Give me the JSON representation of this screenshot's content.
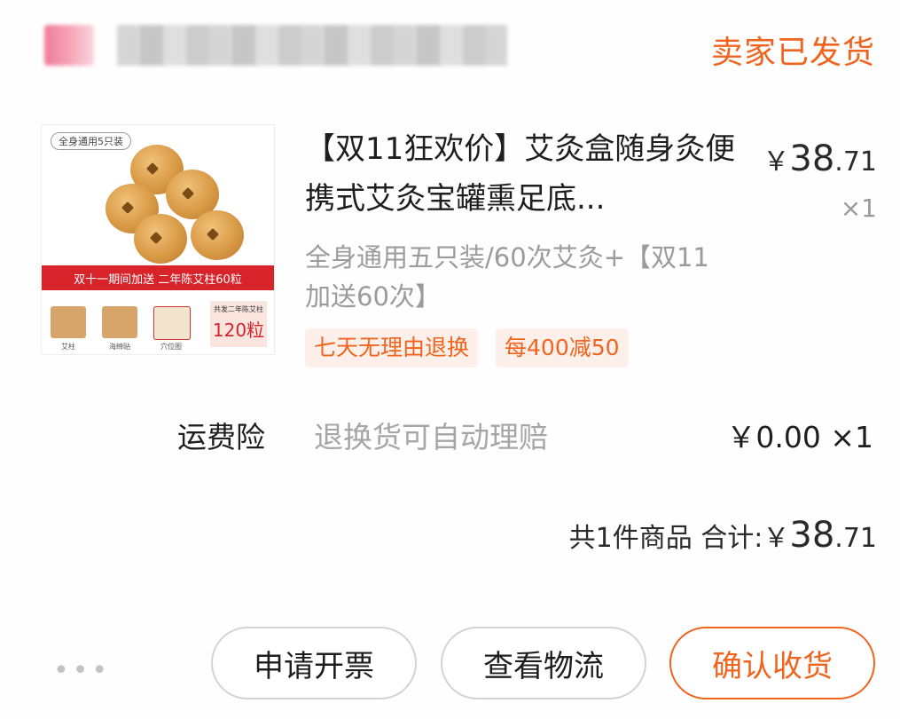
{
  "header": {
    "status": "卖家已发货"
  },
  "product": {
    "image": {
      "tag": "全身通用5只装",
      "band_text": "双十一期间加送 二年陈艾柱60粒",
      "count_small": "共发二年陈艾柱",
      "count_big": "120粒",
      "pack_labels": [
        "艾柱",
        "海绵贴",
        "穴位图"
      ]
    },
    "title": "【双11狂欢价】艾灸盒随身灸便携式艾灸宝罐熏足底...",
    "price": {
      "yen": "￥",
      "integer": "38",
      "decimal": ".71"
    },
    "quantity": "×1",
    "sku": "全身通用五只装/60次艾灸+【双11加送60次】",
    "tags": [
      "七天无理由退换",
      "每400减50"
    ]
  },
  "insurance": {
    "label": "运费险",
    "description": "退换货可自动理赔",
    "price": "￥0.00 ×1"
  },
  "summary": {
    "count_text": "共1件商品 合计:",
    "yen": "￥",
    "integer": "38",
    "decimal": ".71"
  },
  "actions": {
    "more": "•••",
    "invoice": "申请开票",
    "logistics": "查看物流",
    "confirm": "确认收货"
  },
  "colors": {
    "accent": "#f0641e",
    "tag_bg": "#fdf0ea",
    "text": "#1e1e1e",
    "muted": "#9b9b9b"
  }
}
